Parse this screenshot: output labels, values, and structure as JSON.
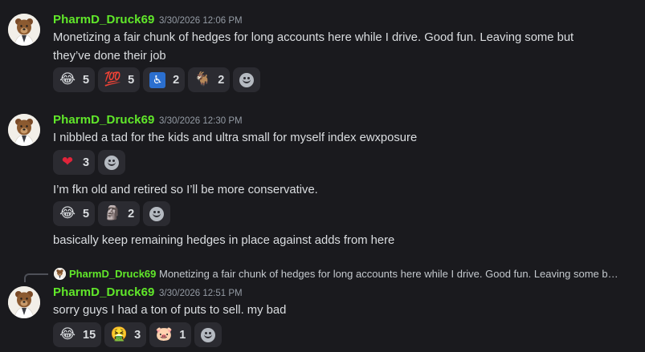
{
  "messages": [
    {
      "author": "PharmD_Druck69",
      "timestamp": "3/30/2026 12:06 PM",
      "lines": [
        "Monetizing a fair chunk of hedges for long accounts here while I drive. Good fun. Leaving some but",
        "they’ve done their job"
      ],
      "reactions": [
        {
          "emoji": "😂",
          "count": "5"
        },
        {
          "emoji": "💯",
          "count": "5"
        },
        {
          "emoji": "♿",
          "count": "2"
        },
        {
          "emoji": "🐐",
          "count": "2"
        }
      ]
    },
    {
      "author": "PharmD_Druck69",
      "timestamp": "3/30/2026 12:30 PM",
      "text": "I nibbled a tad for the kids and ultra small for myself index ewxposure",
      "reactions": [
        {
          "emoji": "❤",
          "count": "3"
        }
      ],
      "followups": [
        {
          "text": "I’m fkn old and retired so I’ll be more conservative.",
          "reactions": [
            {
              "emoji": "😂",
              "count": "5"
            },
            {
              "emoji": "🗿",
              "count": "2"
            }
          ]
        },
        {
          "text": "basically keep remaining hedges in place against adds from here"
        }
      ]
    },
    {
      "reply_to": {
        "author": "PharmD_Druck69",
        "text": "Monetizing a fair chunk of hedges for long accounts here while I drive. Good fun. Leaving some b…"
      },
      "author": "PharmD_Druck69",
      "timestamp": "3/30/2026 12:51 PM",
      "text": "sorry guys I had a ton of puts to sell. my bad",
      "reactions": [
        {
          "emoji": "😂",
          "count": "15"
        },
        {
          "emoji": "🤮",
          "count": "3"
        },
        {
          "emoji": "🐷",
          "count": "1"
        }
      ]
    }
  ],
  "icons": {
    "add_reaction": "smile-plus-icon",
    "avatar": "bear-in-lab-coat"
  },
  "colors": {
    "background": "#1a1a1e",
    "username": "#61e82a",
    "reaction_bg": "#2b2b31",
    "text": "#dbdee1",
    "timestamp": "#949ba4"
  }
}
